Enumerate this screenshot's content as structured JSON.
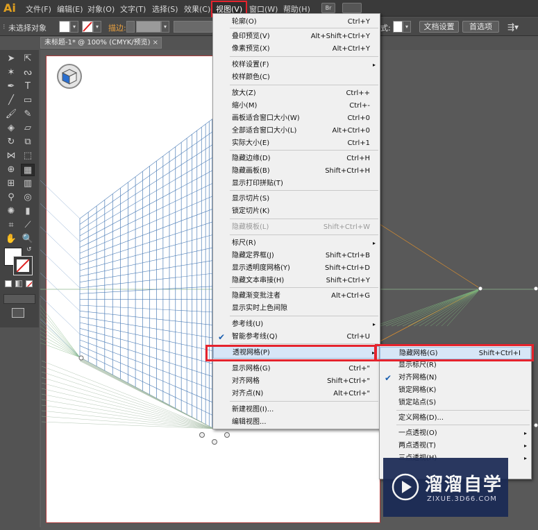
{
  "app": {
    "logo": "Ai"
  },
  "menubar": {
    "items": [
      "文件(F)",
      "编辑(E)",
      "对象(O)",
      "文字(T)",
      "选择(S)",
      "效果(C)",
      "视图(V)",
      "窗口(W)",
      "帮助(H)"
    ],
    "bridge_label": "Br"
  },
  "controlbar": {
    "selection": "未选择对象",
    "stroke_label": "描边:",
    "style_label": "式:",
    "doc_setup": "文档设置",
    "preferences": "首选项"
  },
  "tab": {
    "title": "未标题-1* @ 100% (CMYK/预览)",
    "close": "×"
  },
  "view_menu": {
    "items": [
      {
        "label": "轮廓(O)",
        "shortcut": "Ctrl+Y"
      },
      {
        "label": "叠印预览(V)",
        "shortcut": "Alt+Shift+Ctrl+Y"
      },
      {
        "label": "像素预览(X)",
        "shortcut": "Alt+Ctrl+Y"
      },
      {
        "label": "校样设置(F)",
        "shortcut": ""
      },
      {
        "label": "校样颜色(C)",
        "shortcut": ""
      },
      {
        "label": "放大(Z)",
        "shortcut": "Ctrl++"
      },
      {
        "label": "缩小(M)",
        "shortcut": "Ctrl+-"
      },
      {
        "label": "画板适合窗口大小(W)",
        "shortcut": "Ctrl+0"
      },
      {
        "label": "全部适合窗口大小(L)",
        "shortcut": "Alt+Ctrl+0"
      },
      {
        "label": "实际大小(E)",
        "shortcut": "Ctrl+1"
      },
      {
        "label": "隐藏边缘(D)",
        "shortcut": "Ctrl+H"
      },
      {
        "label": "隐藏画板(B)",
        "shortcut": "Shift+Ctrl+H"
      },
      {
        "label": "显示打印拼贴(T)",
        "shortcut": ""
      },
      {
        "label": "显示切片(S)",
        "shortcut": ""
      },
      {
        "label": "锁定切片(K)",
        "shortcut": ""
      },
      {
        "label": "隐藏模板(L)",
        "shortcut": "Shift+Ctrl+W"
      },
      {
        "label": "标尺(R)",
        "shortcut": ""
      },
      {
        "label": "隐藏定界框(J)",
        "shortcut": "Shift+Ctrl+B"
      },
      {
        "label": "显示透明度网格(Y)",
        "shortcut": "Shift+Ctrl+D"
      },
      {
        "label": "隐藏文本串接(H)",
        "shortcut": "Shift+Ctrl+Y"
      },
      {
        "label": "隐藏渐变批注者",
        "shortcut": "Alt+Ctrl+G"
      },
      {
        "label": "显示实时上色间隙",
        "shortcut": ""
      },
      {
        "label": "参考线(U)",
        "shortcut": ""
      },
      {
        "label": "智能参考线(Q)",
        "shortcut": "Ctrl+U"
      },
      {
        "label": "透视网格(P)",
        "shortcut": ""
      },
      {
        "label": "显示网格(G)",
        "shortcut": "Ctrl+\""
      },
      {
        "label": "对齐网格",
        "shortcut": "Shift+Ctrl+\""
      },
      {
        "label": "对齐点(N)",
        "shortcut": "Alt+Ctrl+\""
      },
      {
        "label": "新建视图(I)...",
        "shortcut": ""
      },
      {
        "label": "编辑视图...",
        "shortcut": ""
      }
    ]
  },
  "perspective_submenu": {
    "items": [
      {
        "label": "隐藏网格(G)",
        "shortcut": "Shift+Ctrl+I"
      },
      {
        "label": "显示标尺(R)",
        "shortcut": ""
      },
      {
        "label": "对齐网格(N)",
        "shortcut": ""
      },
      {
        "label": "锁定网格(K)",
        "shortcut": ""
      },
      {
        "label": "锁定站点(S)",
        "shortcut": ""
      },
      {
        "label": "定义网格(D)...",
        "shortcut": ""
      },
      {
        "label": "一点透视(O)",
        "shortcut": ""
      },
      {
        "label": "两点透视(T)",
        "shortcut": ""
      },
      {
        "label": "三点透视(H)",
        "shortcut": ""
      }
    ]
  },
  "watermark": {
    "title": "溜溜自学",
    "subtitle": "ZIXUE.3D66.COM"
  }
}
